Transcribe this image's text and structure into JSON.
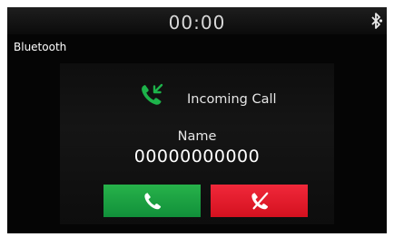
{
  "status_bar": {
    "time": "00:00",
    "bluetooth_icon": "bluetooth-phone-icon"
  },
  "app_title": "Bluetooth",
  "call": {
    "title": "Incoming Call",
    "caller_name": "Name",
    "caller_number": "00000000000",
    "icon": "incoming-call-icon"
  },
  "buttons": {
    "accept_icon": "phone-icon",
    "reject_icon": "hang-up-icon"
  },
  "colors": {
    "accent_green": "#1aa344",
    "reject_red": "#e41b2b",
    "background": "#050505"
  }
}
